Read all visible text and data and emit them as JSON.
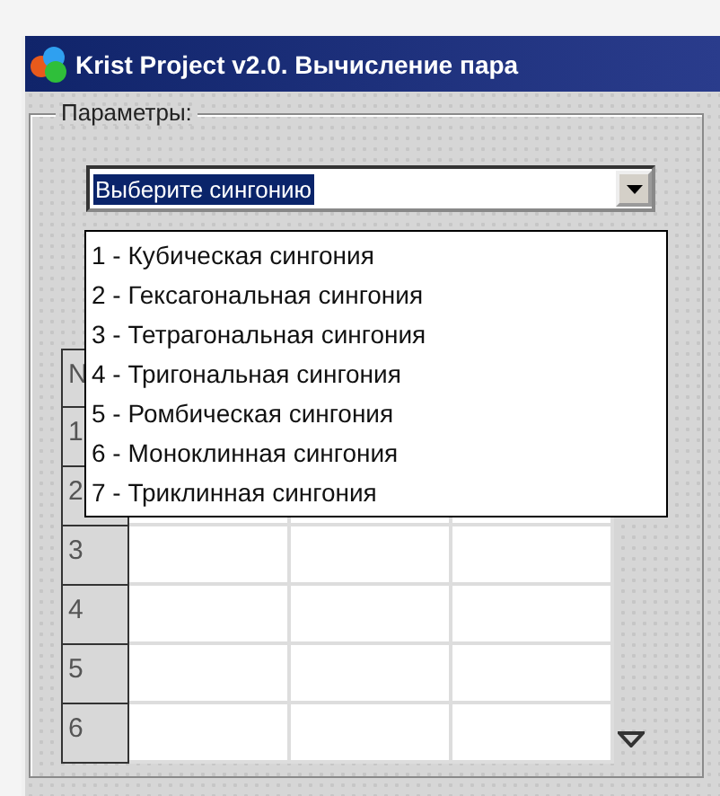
{
  "window": {
    "title": "Krist Project v2.0. Вычисление пара"
  },
  "parameters": {
    "label": "Параметры:",
    "combo": {
      "value": "Выберите сингонию",
      "text_selected": true,
      "expanded": true
    },
    "options": [
      {
        "label": "1 - Кубическая сингония",
        "selected": false
      },
      {
        "label": "2 - Гексагональная сингония",
        "selected": false
      },
      {
        "label": "3 - Тетрагональная сингония",
        "selected": false
      },
      {
        "label": "4 - Тригональная сингония",
        "selected": false
      },
      {
        "label": "5 - Ромбическая сингония",
        "selected": false
      },
      {
        "label": "6 - Моноклинная сингония",
        "selected": false
      },
      {
        "label": "7 - Триклинная сингония",
        "selected": false
      }
    ],
    "table": {
      "row_headers": [
        "N",
        "1",
        "2",
        "3",
        "4",
        "5",
        "6"
      ]
    }
  }
}
